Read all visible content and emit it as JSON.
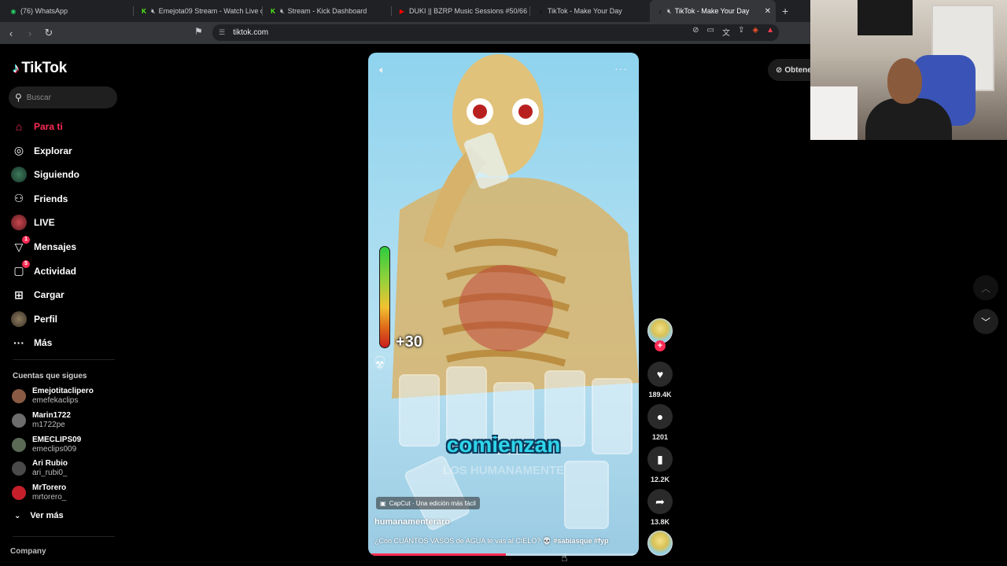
{
  "browser": {
    "tabs": [
      {
        "title": "(76) WhatsApp",
        "favicon": "whatsapp-icon",
        "muted": false,
        "active": false,
        "color": "#25d366",
        "glyph": "◉"
      },
      {
        "title": "Emejota09 Stream - Watch Live o",
        "favicon": "kick-icon",
        "muted": true,
        "active": false,
        "color": "#53fc18",
        "glyph": "K"
      },
      {
        "title": "Stream - Kick Dashboard",
        "favicon": "kick-icon",
        "muted": true,
        "active": false,
        "color": "#53fc18",
        "glyph": "K"
      },
      {
        "title": "DUKI || BZRP Music Sessions #50/66",
        "favicon": "youtube-icon",
        "muted": false,
        "active": false,
        "color": "#ff0000",
        "glyph": "▶"
      },
      {
        "title": "TikTok - Make Your Day",
        "favicon": "tiktok-icon",
        "muted": false,
        "active": false,
        "color": "#000000",
        "glyph": "♪"
      },
      {
        "title": "TikTok - Make Your Day",
        "favicon": "tiktok-icon",
        "muted": true,
        "active": true,
        "color": "#000000",
        "glyph": "♪"
      }
    ],
    "close_glyph": "✕",
    "new_tab_glyph": "+",
    "url": "tiktok.com"
  },
  "sidebar": {
    "logo_text": "TikTok",
    "search_placeholder": "Buscar",
    "nav": [
      {
        "label": "Para ti",
        "icon": "home-icon",
        "glyph": "⌂",
        "active": true
      },
      {
        "label": "Explorar",
        "icon": "compass-icon",
        "glyph": "◎",
        "active": false
      },
      {
        "label": "Siguiendo",
        "icon": "following-avatar-icon",
        "glyph": "",
        "active": false
      },
      {
        "label": "Friends",
        "icon": "friends-icon",
        "glyph": "⚇",
        "active": false
      },
      {
        "label": "LIVE",
        "icon": "live-avatar-icon",
        "glyph": "",
        "active": false
      },
      {
        "label": "Mensajes",
        "icon": "messages-icon",
        "glyph": "▽",
        "active": false,
        "badge": "1"
      },
      {
        "label": "Actividad",
        "icon": "activity-icon",
        "glyph": "▢",
        "active": false,
        "badge": "5"
      },
      {
        "label": "Cargar",
        "icon": "upload-icon",
        "glyph": "⊞",
        "active": false
      },
      {
        "label": "Perfil",
        "icon": "profile-avatar-icon",
        "glyph": "",
        "active": false
      },
      {
        "label": "Más",
        "icon": "more-icon",
        "glyph": "···",
        "active": false
      }
    ],
    "following_title": "Cuentas que sigues",
    "following": [
      {
        "name": "Emejotitaclipero",
        "handle": "emefekaclips",
        "color": "#8a5a44"
      },
      {
        "name": "Marin1722",
        "handle": "m1722pe",
        "color": "#6d6d6d"
      },
      {
        "name": "EMECLIPS09",
        "handle": "emeclips009",
        "color": "#5a6a55"
      },
      {
        "name": "Ari Rubio",
        "handle": "ari_rubi0_",
        "color": "#4a4a4a"
      },
      {
        "name": "MrTorero",
        "handle": "mrtorero_",
        "color": "#c51f2a"
      }
    ],
    "see_more": "Ver más",
    "company": "Company"
  },
  "video": {
    "meter_value": "+30",
    "meter_level": 0.25,
    "caption_big": "comienzan",
    "caption_faint": "LOS HUMANAMENTE",
    "capcut_label": "CapCut · Una edición más fácil",
    "author": "humanamenteraro",
    "description": "¿Con CUÁNTOS VASOS de AGUA te vas al CIELO? 💀",
    "hashtags": "#sabiasque #fyp",
    "progress": 0.51
  },
  "actions": {
    "likes": "189.4K",
    "comments": "1201",
    "saves": "12.2K",
    "shares": "13.8K"
  },
  "get_app_label": "Obtene"
}
